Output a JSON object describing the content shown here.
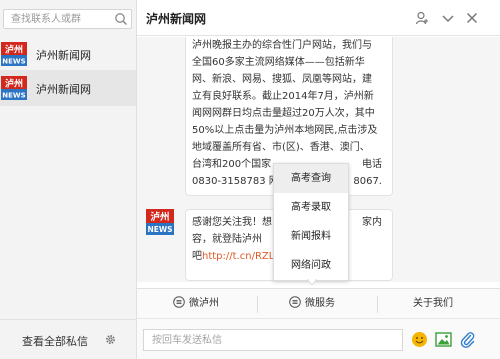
{
  "sidebar": {
    "search_placeholder": "查找联系人或群",
    "conversations": [
      {
        "name": "泸州新闻网",
        "avatar_text_top": "泸州",
        "avatar_text_bottom": "NEWS"
      },
      {
        "name": "泸州新闻网",
        "avatar_text_top": "泸州",
        "avatar_text_bottom": "NEWS"
      }
    ],
    "footer_label": "查看全部私信"
  },
  "header": {
    "title": "泸州新闻网"
  },
  "messages": [
    {
      "lines": [
        "泸州晚报主办的综合性门户网站，我们与",
        "全国60多家主流网络媒体——包括新华",
        "网、新浪、网易、搜狐、凤凰等网站，建",
        "立有良好联系。截止2014年7月，泸州新",
        "闻网网群日均点击量超过20万人次，其中",
        "50%以上点击量为泸州本地网民,点击涉及",
        "地域覆盖所有省、市(区)、香港、澳门、",
        "台湾和200个国家",
        "0830-3158783 网"
      ],
      "tail_line_end": "电话",
      "tail_line_end2": "8067."
    },
    {
      "line1": "感谢您关注我！想",
      "line1_end": "家内",
      "line2": "容，就登陆泸州",
      "line3_prefix": "吧",
      "line3_link": "http://t.cn/RZL("
    }
  ],
  "chat_avatar": {
    "text_top": "泸州",
    "text_bottom": "NEWS"
  },
  "popup_menu": {
    "items": [
      "高考查询",
      "高考录取",
      "新闻报料",
      "网络问政"
    ]
  },
  "bottom_menu": {
    "items": [
      "微泸州",
      "微服务",
      "关于我们"
    ]
  },
  "composer": {
    "placeholder": "按回车发送私信"
  },
  "colors": {
    "avatar_red": "#d2281e",
    "avatar_blue": "#2b74c4",
    "link": "#e05a2a",
    "emoji": "#f5b400",
    "image_icon": "#3a9e3a",
    "attach": "#2f7fd0"
  }
}
